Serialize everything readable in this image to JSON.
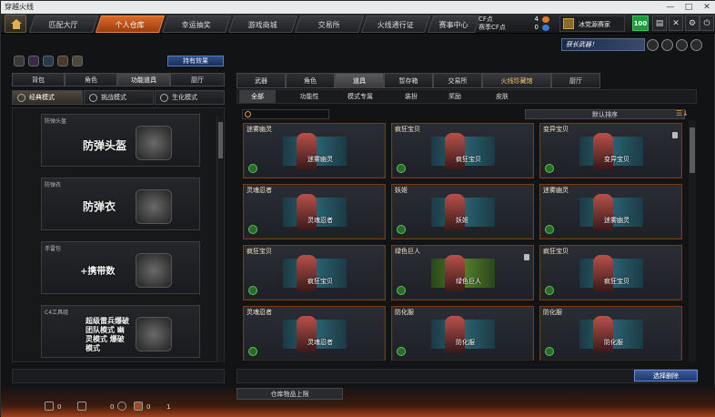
{
  "window": {
    "title": "穿越火线",
    "controls": [
      "—",
      "□",
      "✕"
    ]
  },
  "topnav": {
    "tabs": [
      "匹配大厅",
      "个人仓库",
      "幸运抽奖",
      "游戏商城",
      "交易所",
      "火线通行证",
      "赛事中心"
    ],
    "active": 1
  },
  "currency": {
    "cf_label": "CF点",
    "cf_value": "4",
    "esport_label": "赛季CF点",
    "esport_value": "0",
    "rank_name": "冰党源赛家",
    "level": "100"
  },
  "left": {
    "holding_button": "持有效果",
    "tabs": [
      "背包",
      "角色",
      "功能道具",
      "厨厅"
    ],
    "active_tab": 2,
    "modes": [
      "经典模式",
      "挑战模式",
      "生化模式"
    ],
    "active_mode": 0,
    "items": [
      {
        "caption": "防弹头盔",
        "title": "防弹头盔"
      },
      {
        "caption": "防弹衣",
        "title": "防弹衣"
      },
      {
        "caption": "手雷包",
        "title": "+携带数"
      },
      {
        "caption": "C4工具组",
        "title": "超级雷兵爆破 团队模式 幽灵模式 爆破模式"
      }
    ]
  },
  "banner": {
    "text": "获长武器！"
  },
  "right": {
    "tabs": [
      "武器",
      "角色",
      "道具",
      "暂存箱",
      "交易所",
      "火线珍藏馆",
      "厨厅"
    ],
    "active_tab": 2,
    "subtabs": [
      "全部",
      "功能性",
      "模式专属",
      "装扮",
      "奖励",
      "皮肤"
    ],
    "active_subtab": 0,
    "sort_label": "默认排序",
    "sell_button": "选择删除",
    "store_button": "仓库物品上限"
  },
  "cards": [
    {
      "name": "迷雾幽灵",
      "label": "迷雾幽灵",
      "green": false,
      "lock": false
    },
    {
      "name": "疯狂宝贝",
      "label": "疯狂宝贝",
      "green": false,
      "lock": false
    },
    {
      "name": "变异宝贝",
      "label": "变异宝贝",
      "green": false,
      "lock": true
    },
    {
      "name": "灵魂忍者",
      "label": "灵魂忍者",
      "green": false,
      "lock": false
    },
    {
      "name": "妖姬",
      "label": "妖姬",
      "green": false,
      "lock": false
    },
    {
      "name": "迷雾幽灵",
      "label": "迷雾幽灵",
      "green": false,
      "lock": false
    },
    {
      "name": "疯狂宝贝",
      "label": "疯狂宝贝",
      "green": false,
      "lock": false
    },
    {
      "name": "绿色巨人",
      "label": "绿色巨人",
      "green": true,
      "lock": true
    },
    {
      "name": "疯狂宝贝",
      "label": "疯狂宝贝",
      "green": false,
      "lock": false
    },
    {
      "name": "灵魂忍者",
      "label": "灵魂忍者",
      "green": false,
      "lock": false
    },
    {
      "name": "防化服",
      "label": "防化服",
      "green": false,
      "lock": false
    },
    {
      "name": "防化服",
      "label": "防化服",
      "green": false,
      "lock": false
    }
  ],
  "footer": {
    "stat1": "0",
    "stat2": "0",
    "stat3": "0",
    "stat4": "1"
  }
}
